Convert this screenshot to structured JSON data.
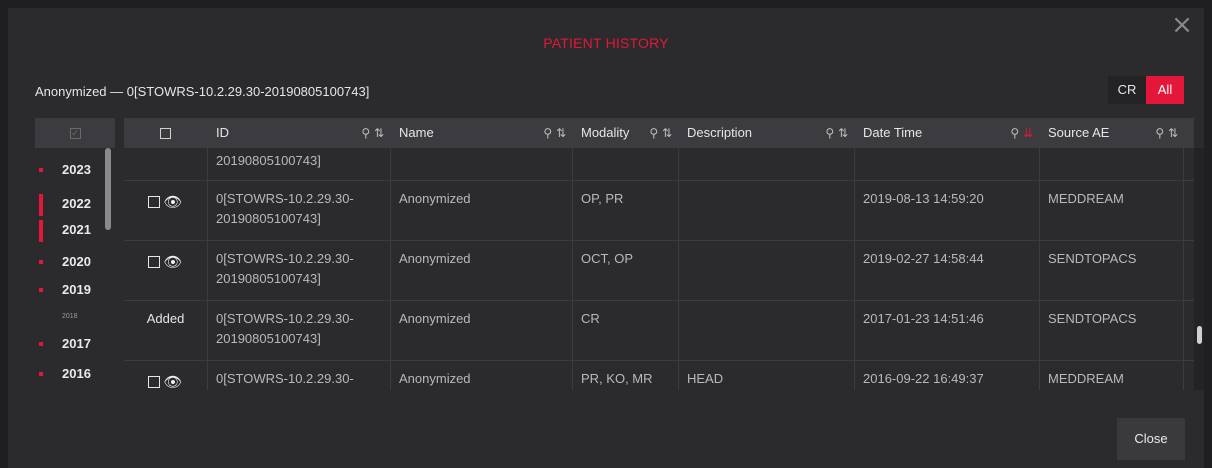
{
  "dialog": {
    "title": "PATIENT HISTORY",
    "subtitle": "Anonymized — 0[STOWRS-10.2.29.30-20190805100743]",
    "close_x": "×",
    "close_button": "Close"
  },
  "filter": {
    "cr_label": "CR",
    "all_label": "All"
  },
  "years": [
    {
      "label": "2023"
    },
    {
      "label": "2022"
    },
    {
      "label": "2021"
    },
    {
      "label": "2020"
    },
    {
      "label": "2019"
    },
    {
      "label": "2018"
    },
    {
      "label": "2017"
    },
    {
      "label": "2016"
    }
  ],
  "table": {
    "headers": {
      "id": "ID",
      "name": "Name",
      "modality": "Modality",
      "description": "Description",
      "datetime": "Date Time",
      "source": "Source AE"
    },
    "icons": {
      "search": "search-icon",
      "sort": "sort-icon",
      "eye": "eye-icon"
    },
    "rows": [
      {
        "action": "",
        "id_line1": "",
        "id_line2": "20190805100743]",
        "name": "",
        "modality": "",
        "description": "",
        "datetime": "",
        "source": ""
      },
      {
        "action": "view",
        "id_line1": "0[STOWRS-10.2.29.30-",
        "id_line2": "20190805100743]",
        "name": "Anonymized",
        "modality": "OP, PR",
        "description": "",
        "datetime": "2019-08-13 14:59:20",
        "source": "MEDDREAM"
      },
      {
        "action": "view",
        "id_line1": "0[STOWRS-10.2.29.30-",
        "id_line2": "20190805100743]",
        "name": "Anonymized",
        "modality": "OCT, OP",
        "description": "",
        "datetime": "2019-02-27 14:58:44",
        "source": "SENDTOPACS"
      },
      {
        "action": "added",
        "added_label": "Added",
        "id_line1": "0[STOWRS-10.2.29.30-",
        "id_line2": "20190805100743]",
        "name": "Anonymized",
        "modality": "CR",
        "description": "",
        "datetime": "2017-01-23 14:51:46",
        "source": "SENDTOPACS"
      },
      {
        "action": "view",
        "id_line1": "0[STOWRS-10.2.29.30-",
        "id_line2": "",
        "name": "Anonymized",
        "modality": "PR, KO, MR",
        "description": "HEAD",
        "datetime": "2016-09-22 16:49:37",
        "source": "MEDDREAM"
      }
    ]
  },
  "colors": {
    "accent": "#e4163a",
    "added": "#3dd13d",
    "background": "#2b2b2e",
    "header": "#3c3c40"
  }
}
